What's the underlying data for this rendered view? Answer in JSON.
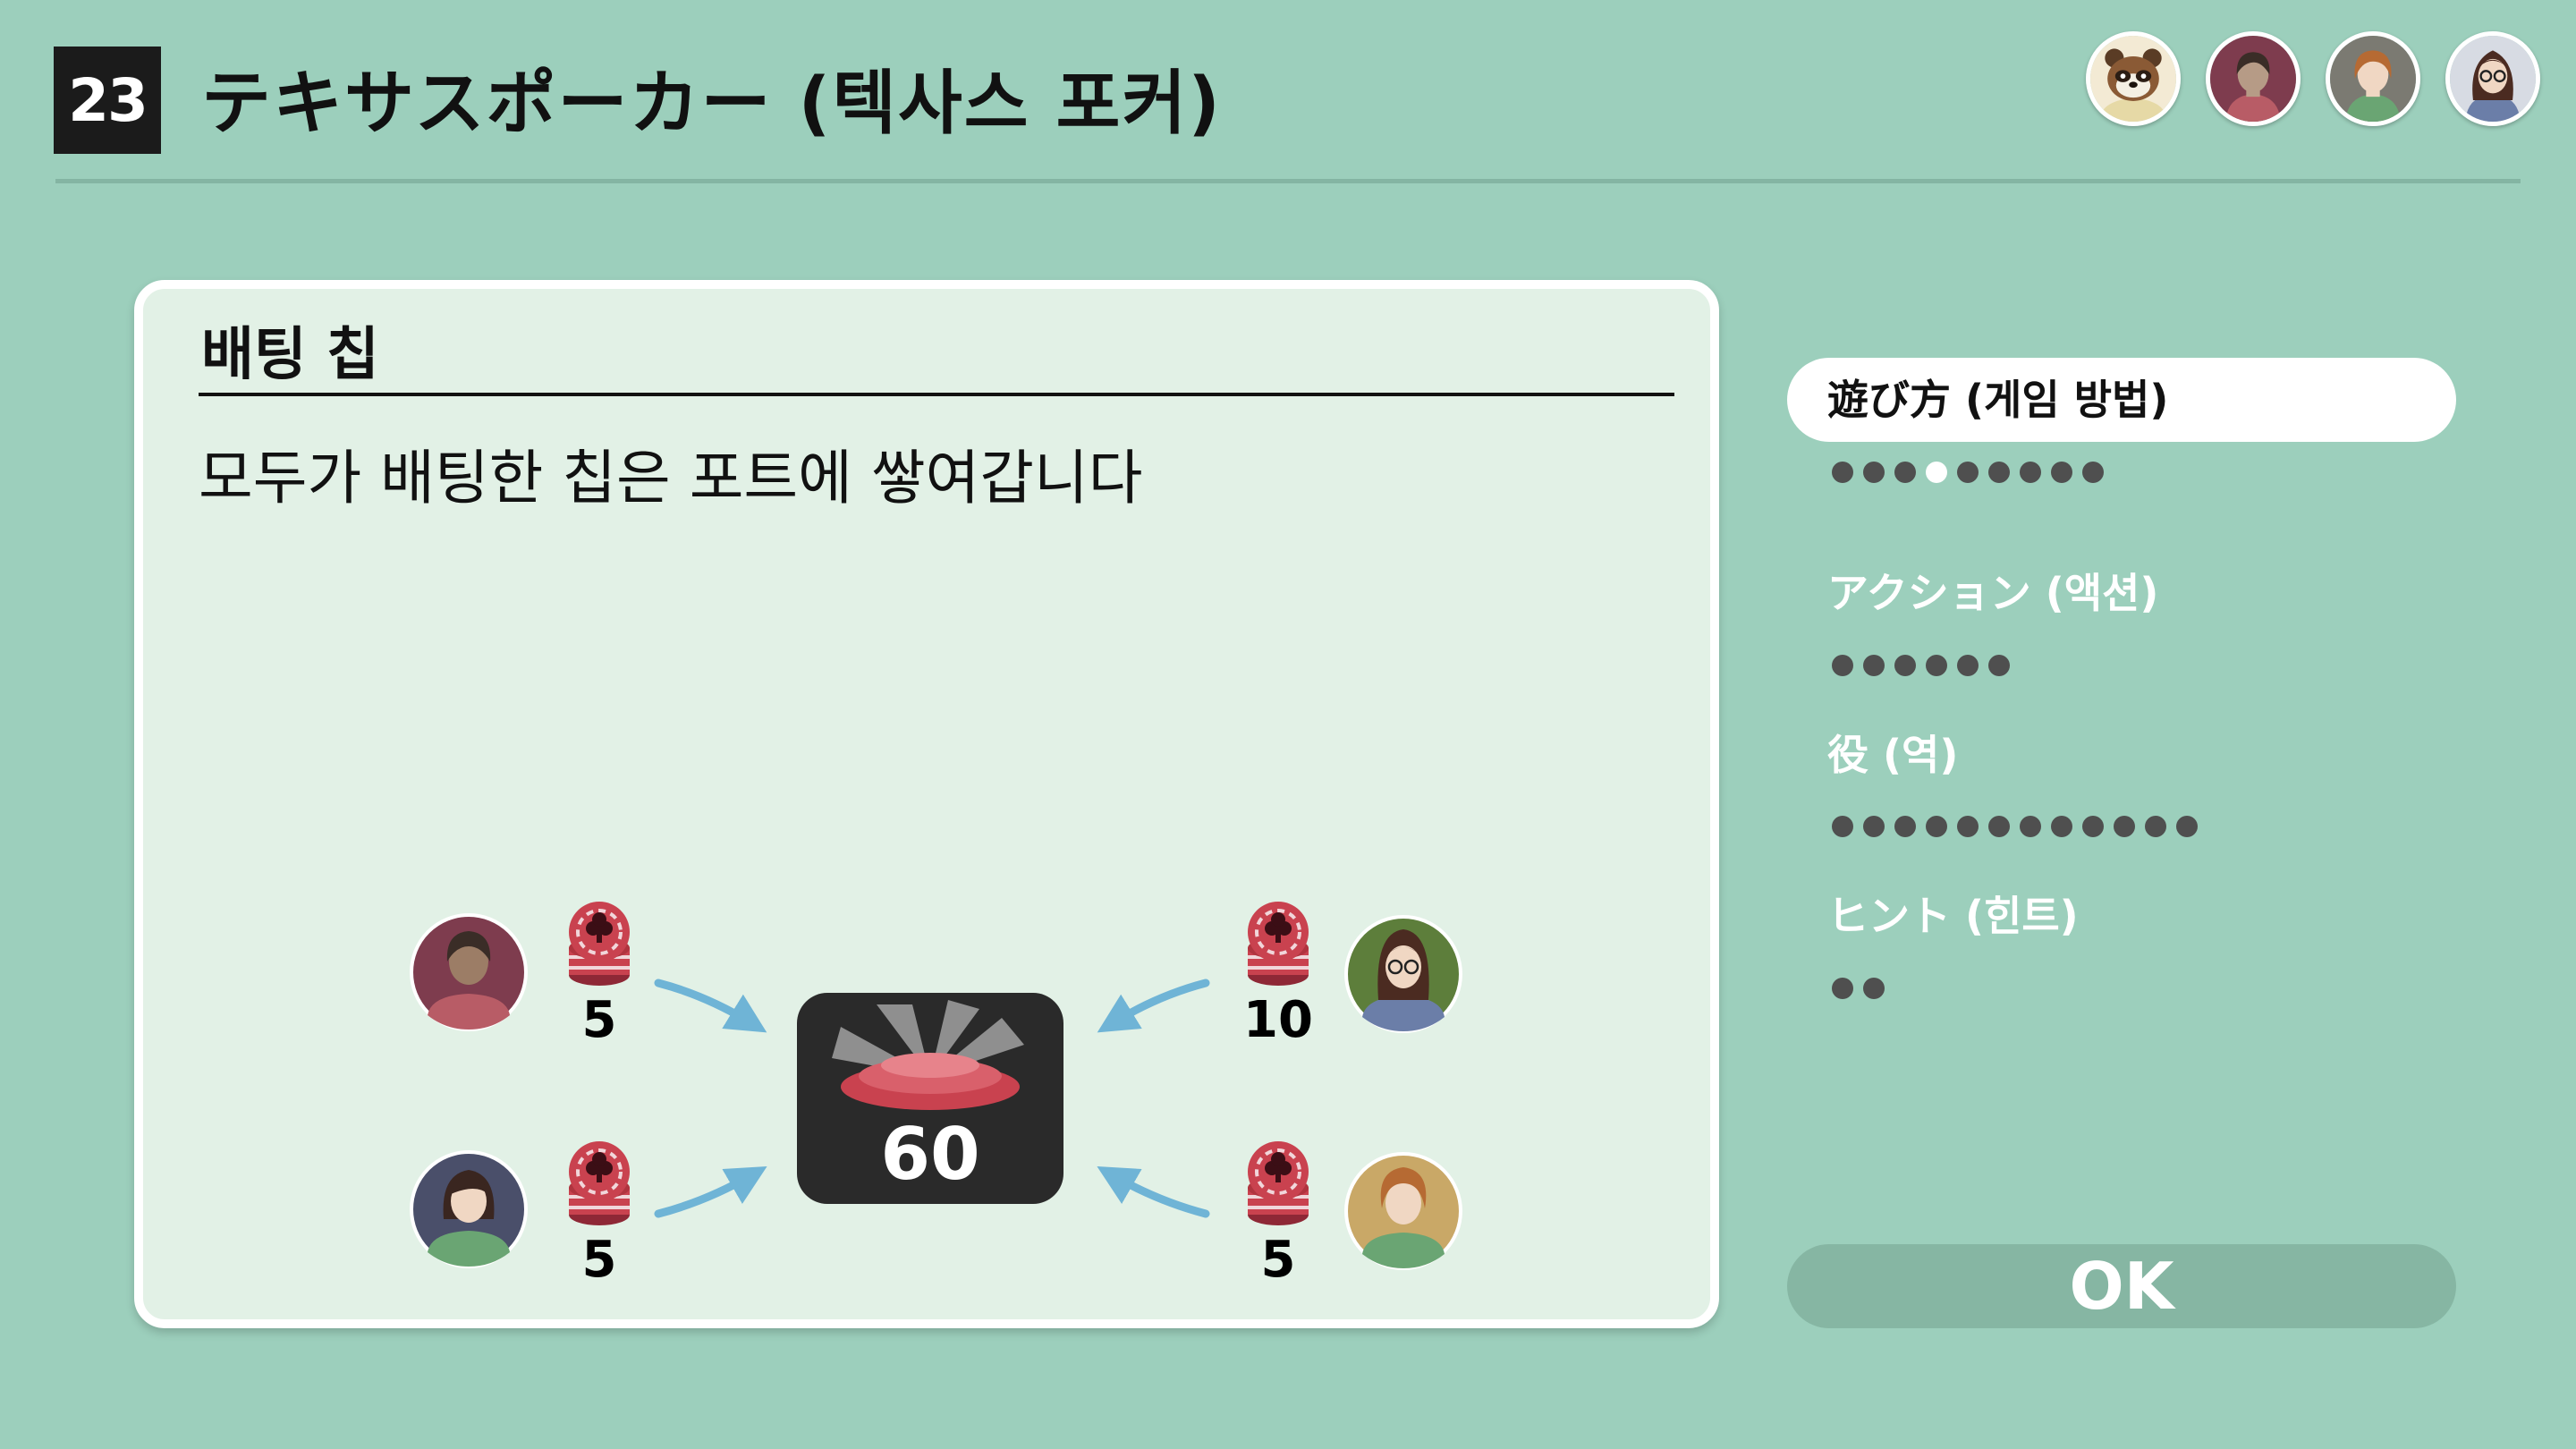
{
  "header": {
    "game_number": "23",
    "title": "テキサスポーカー (텍사스 포커)"
  },
  "players": [
    {
      "icon": "raccoon-villager-avatar-icon"
    },
    {
      "icon": "dark-hair-player-avatar-icon"
    },
    {
      "icon": "orange-hair-player-avatar-icon"
    },
    {
      "icon": "glasses-player-avatar-icon"
    }
  ],
  "card": {
    "title": "배팅 칩",
    "text": "모두가 배팅한 칩은 포트에 쌓여갑니다",
    "pot_value": "60",
    "bets": [
      {
        "position": "top-left",
        "amount": "5",
        "avatar": "brown-hair-player-icon"
      },
      {
        "position": "bottom-left",
        "amount": "5",
        "avatar": "dark-hair-player-icon"
      },
      {
        "position": "top-right",
        "amount": "10",
        "avatar": "glasses-player-icon"
      },
      {
        "position": "bottom-right",
        "amount": "5",
        "avatar": "orange-hair-player-icon"
      }
    ]
  },
  "menu": {
    "items": [
      {
        "label": "遊び方 (게임 방법)",
        "active": true,
        "dot_count": 9,
        "current_dot": 4
      },
      {
        "label": "アクション (액션)",
        "active": false,
        "dot_count": 6
      },
      {
        "label": "役 (역)",
        "active": false,
        "dot_count": 12
      },
      {
        "label": "ヒント (힌트)",
        "active": false,
        "dot_count": 2
      }
    ],
    "ok_label": "OK"
  },
  "colors": {
    "background": "#9ccfbc",
    "card": "#e2f1e6",
    "chip": "#c9424f",
    "arrow": "#6fb4d6"
  }
}
